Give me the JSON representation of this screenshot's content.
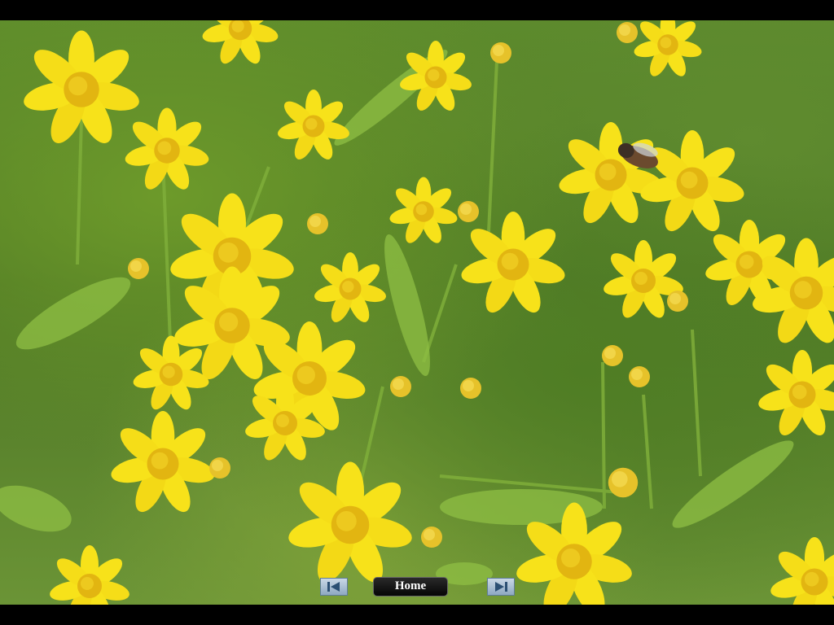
{
  "controls": {
    "prev_icon": "skip-previous-icon",
    "home_label": "Home",
    "next_icon": "skip-next-icon"
  },
  "photo": {
    "subject": "yellow-wildflowers"
  },
  "colors": {
    "frame": "#000000",
    "petal": "#f7e21a",
    "center": "#e2b511",
    "foliage": "#5c8a2c",
    "button_face": "#a9c0d6"
  }
}
